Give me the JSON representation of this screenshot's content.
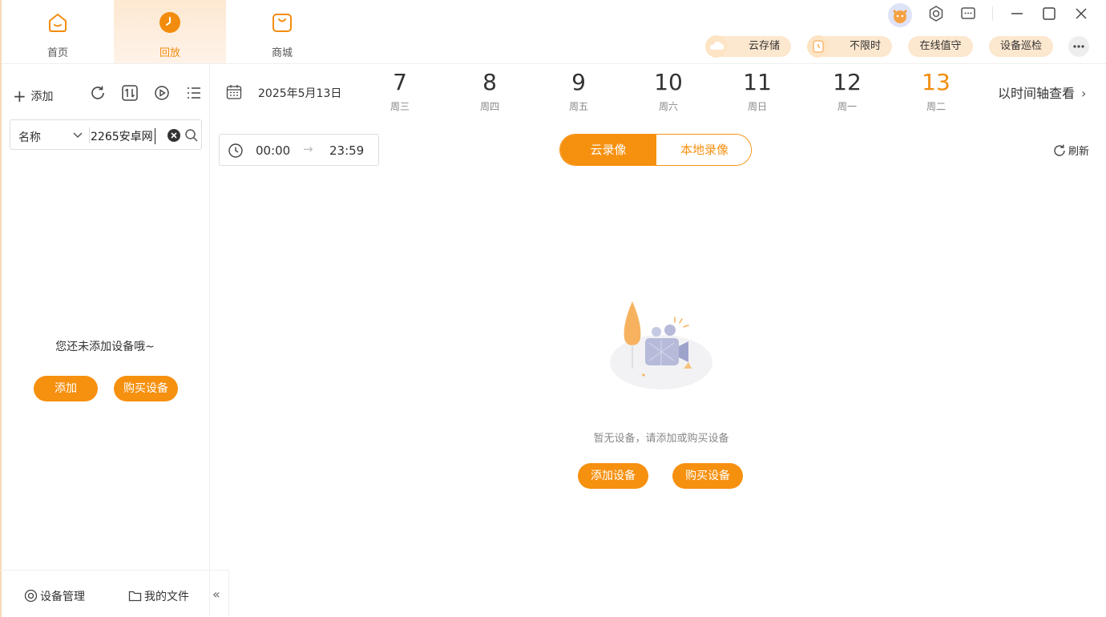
{
  "nav": {
    "tabs": [
      {
        "label": "首页",
        "icon": "home-icon"
      },
      {
        "label": "回放",
        "icon": "playback-clock-icon"
      },
      {
        "label": "商城",
        "icon": "shop-bag-icon"
      }
    ],
    "active": "回放"
  },
  "services": [
    {
      "label": "云存储",
      "icon": "cloud-icon"
    },
    {
      "label": "不限时",
      "icon": "timer-icon"
    },
    {
      "label": "在线值守"
    },
    {
      "label": "设备巡检"
    }
  ],
  "window_controls": [
    "avatar",
    "settings-icon",
    "message-icon",
    "minimize-icon",
    "maximize-icon",
    "close-icon"
  ],
  "left": {
    "add_label": "添加",
    "search": {
      "field": "名称",
      "value": "2265安卓网"
    },
    "empty_text": "您还未添加设备哦~",
    "add_button": "添加",
    "buy_button": "购买设备",
    "footer": {
      "device_mgmt": "设备管理",
      "my_files": "我的文件",
      "collapse": "«"
    }
  },
  "main": {
    "date": "2025年5月13日",
    "days": [
      {
        "num": "7",
        "wk": "周三"
      },
      {
        "num": "8",
        "wk": "周四"
      },
      {
        "num": "9",
        "wk": "周五"
      },
      {
        "num": "10",
        "wk": "周六"
      },
      {
        "num": "11",
        "wk": "周日"
      },
      {
        "num": "12",
        "wk": "周一"
      },
      {
        "num": "13",
        "wk": "周二"
      }
    ],
    "active_day": "13",
    "timeline_link": "以时间轴查看",
    "time_start": "00:00",
    "time_arrow": "→",
    "time_end": "23:59",
    "tab_cloud": "云录像",
    "tab_local": "本地录像",
    "refresh": "刷新",
    "empty_text": "暂无设备，请添加或购买设备",
    "add_device": "添加设备",
    "buy_device": "购买设备"
  },
  "colors": {
    "accent": "#f6900f",
    "accent_light": "#fce7cf",
    "text": "#333333"
  }
}
